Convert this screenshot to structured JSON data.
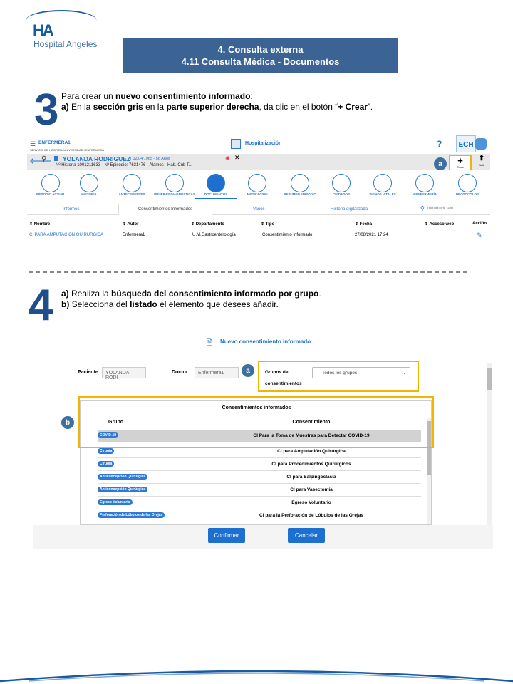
{
  "logo": {
    "text": "Hospital Angeles",
    "mark": "HA"
  },
  "title": {
    "line1": "4. Consulta externa",
    "line2": "4.11 Consulta Médica - Documentos"
  },
  "step3": {
    "number": "3",
    "line1_a": "Para crear un ",
    "line1_b": "nuevo consentimiento informado",
    "line1_c": ":",
    "line2_a": "a)",
    "line2_b": " En la ",
    "line2_c": "sección gris",
    "line2_d": " en la ",
    "line2_e": "parte superior derecha",
    "line2_f": ", da clic en el botón “",
    "line2_g": "+ Crear",
    "line2_h": "”."
  },
  "shot1": {
    "user": "ENFERMERA1",
    "service": "SERVICIO DE HOSPITAL UNIVERSIDAD / ENFERMERÍA",
    "module": "Hospitalización",
    "help": "?",
    "ech": "ECH",
    "patient_name": "YOLANDA RODRIGUEZ",
    "patient_dob": "( 02/04/1965 - 56 Años )",
    "patient_info": "Nº Historia 1001211633 - Nº Episodio: 7631476  - Álamos - Hab. Cub T...",
    "crear_label": "Crear",
    "salir_label": "Salir",
    "marker": "a",
    "tabs": [
      "EPISODIO ACTUAL",
      "HISTORIA",
      "ANTECEDENTES",
      "PRUEBAS DIAGNÓSTICAS",
      "DOCUMENTOS",
      "MEDICACIÓN",
      "RESUMEN EPISODIO",
      "CUIDADOS",
      "SIGNOS VITALES",
      "N.ENFERMERÍA",
      "PROTOCOLOS"
    ],
    "subtabs": [
      "Informes",
      "Consentimientos Informados",
      "Varios",
      "Historia digitalizada"
    ],
    "search_placeholder": "Introducir text...",
    "columns": [
      "Nombre",
      "Autor",
      "Departamento",
      "Tipo",
      "Fecha",
      "Acceso web",
      "Acción"
    ],
    "row": [
      "CI PARA AMPUTACIÓN QUIRÚRGICA",
      "Enfermera1",
      "U.M.Gastroenterología",
      "Consentimiento Informado",
      "27/08/2021 17:24"
    ]
  },
  "step4": {
    "number": "4",
    "line1_a": "a)",
    "line1_b": " Realiza la ",
    "line1_c": "búsqueda del consentimiento informado por grupo",
    "line1_d": ".",
    "line2_a": "b)",
    "line2_b": " Selecciona del ",
    "line2_c": "listado",
    "line2_d": " el elemento que desees añadir."
  },
  "shot2": {
    "dialog_title": "Nuevo consentimiento informado",
    "paciente_label": "Paciente",
    "paciente_value": "YOLANDA RODI",
    "doctor_label": "Doctor",
    "doctor_value": "Enfermera1",
    "grupos_label_1": "Grupos de",
    "grupos_label_2": "consentimientos",
    "grupos_select": "-- Todos los grupos --",
    "marker_a": "a",
    "marker_b": "b",
    "list_title": "Consentimientos informados",
    "col_grupo": "Grupo",
    "col_consentimiento": "Consentimiento",
    "rows": [
      {
        "grupo": "COVID-19",
        "consentimiento": "CI Para la Toma de Muestras para Detectar COVID-19"
      },
      {
        "grupo": "Cirugía",
        "consentimiento": "CI para Amputación Quirúrgica"
      },
      {
        "grupo": "Cirugía",
        "consentimiento": "CI para Procedimientos Quirúrgicos"
      },
      {
        "grupo": "Anticoncepción Quirúrgica",
        "consentimiento": "CI para Salpingoclasia"
      },
      {
        "grupo": "Anticoncepción Quirúrgica",
        "consentimiento": "CI para Vasectomía"
      },
      {
        "grupo": "Egreso Voluntario",
        "consentimiento": "Egreso Voluntario"
      },
      {
        "grupo": "Perforación de Lóbulos de las Orejas",
        "consentimiento": "CI para la Perforación de Lóbulos de las Orejas"
      }
    ],
    "confirm": "Confirmar",
    "cancel": "Cancelar"
  }
}
